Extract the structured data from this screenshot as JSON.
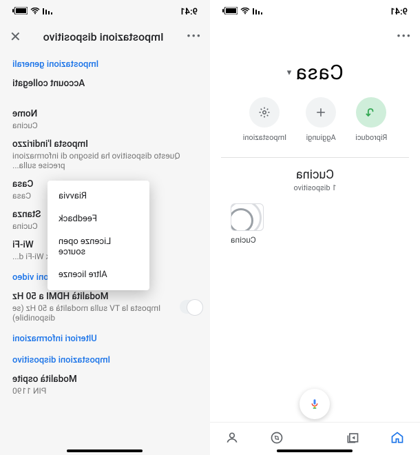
{
  "status": {
    "time": "9:41",
    "signal": "ılıl",
    "wifi": "⋮",
    "battery": ""
  },
  "home": {
    "title": "Casa",
    "actions": {
      "play": {
        "label": "Riproduci"
      },
      "add": {
        "label": "Aggiungi"
      },
      "settings": {
        "label": "Impostazioni"
      }
    },
    "room": {
      "name": "Cucina",
      "sub": "1 dispositivo",
      "device": "Cucina"
    }
  },
  "settings": {
    "title": "Impostazioni dispositivo",
    "sections": {
      "general": "Impostazioni generali",
      "video": "Impostazioni video",
      "moreinfo": "Ulteriori informazioni",
      "device": "Impostazioni dispositivo"
    },
    "linked_accounts": {
      "label": "Account collegati"
    },
    "name": {
      "label": "Nome",
      "value": "Cucina"
    },
    "address": {
      "label": "Imposta l'indirizzo",
      "value": "Questo dispositivo ha bisogno di informazioni precise sulla..."
    },
    "home": {
      "label": "Casa",
      "value": "Casa"
    },
    "room": {
      "label": "Stanza",
      "value": "Cucina"
    },
    "wifi": {
      "label": "Wi-Fi",
      "value": "Network Wi-Fi d..."
    },
    "hdmi": {
      "label": "Modalità HDMI a 50 Hz",
      "value": "Imposta la TV sulla modalità a 50 Hz (se disponibile)"
    },
    "guest": {
      "label": "Modalità ospite",
      "value": "PIN 1190"
    }
  },
  "menu": {
    "items": [
      "Riavvia",
      "Feedback",
      "Licenze open source",
      "Altre licenze"
    ]
  }
}
